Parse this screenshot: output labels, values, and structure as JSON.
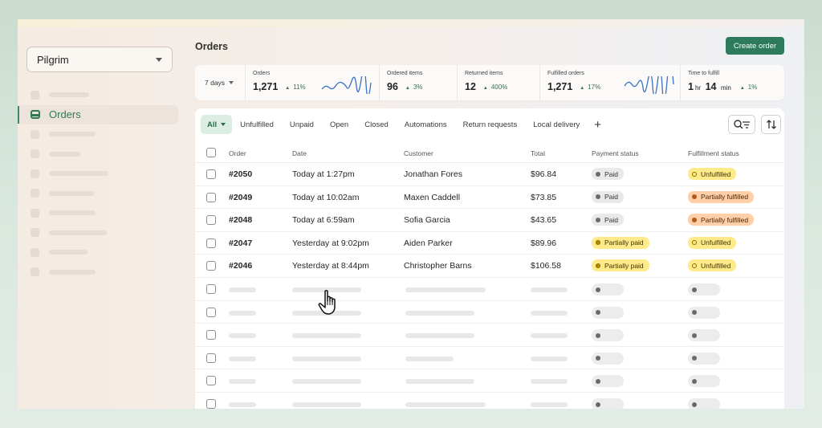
{
  "app": {
    "store_name": "Pilgrim",
    "nav_active_label": "Orders",
    "page_title": "Orders",
    "create_button": "Create order"
  },
  "stats": {
    "period": "7 days",
    "items": [
      {
        "label": "Orders",
        "value": "1,271",
        "delta": "11%"
      },
      {
        "label": "Ordered items",
        "value": "96",
        "delta": "3%"
      },
      {
        "label": "Returned items",
        "value": "12",
        "delta": "400%"
      },
      {
        "label": "Fulfilled orders",
        "value": "1,271",
        "delta": "17%"
      },
      {
        "label": "Time to fulfill",
        "value_hr": "1",
        "unit_hr": "hr",
        "value_min": "14",
        "unit_min": "min",
        "delta": "1%"
      }
    ]
  },
  "tabs": [
    "All",
    "Unfulfilled",
    "Unpaid",
    "Open",
    "Closed",
    "Automations",
    "Return requests",
    "Local delivery"
  ],
  "table": {
    "columns": [
      "Order",
      "Date",
      "Customer",
      "Total",
      "Payment status",
      "Fulfillment status"
    ],
    "rows": [
      {
        "order": "#2050",
        "date": "Today at 1:27pm",
        "customer": "Jonathan Fores",
        "total": "$96.84",
        "payment": "Paid",
        "fulfillment": "Unfulfilled"
      },
      {
        "order": "#2049",
        "date": "Today at 10:02am",
        "customer": "Maxen Caddell",
        "total": "$73.85",
        "payment": "Paid",
        "fulfillment": "Partially fulfilled"
      },
      {
        "order": "#2048",
        "date": "Today at 6:59am",
        "customer": "Sofia Garcia",
        "total": "$43.65",
        "payment": "Paid",
        "fulfillment": "Partially fulfilled"
      },
      {
        "order": "#2047",
        "date": "Yesterday at 9:02pm",
        "customer": "Aiden Parker",
        "total": "$89.96",
        "payment": "Partially paid",
        "fulfillment": "Unfulfilled"
      },
      {
        "order": "#2046",
        "date": "Yesterday at 8:44pm",
        "customer": "Christopher Barns",
        "total": "$106.58",
        "payment": "Partially paid",
        "fulfillment": "Unfulfilled"
      }
    ]
  },
  "colors": {
    "accent": "#2d7a5c",
    "unfulfilled_badge": "#ffea8a",
    "partially_fulfilled_badge": "#ffd0a8",
    "paid_badge": "#e9e9e9"
  }
}
